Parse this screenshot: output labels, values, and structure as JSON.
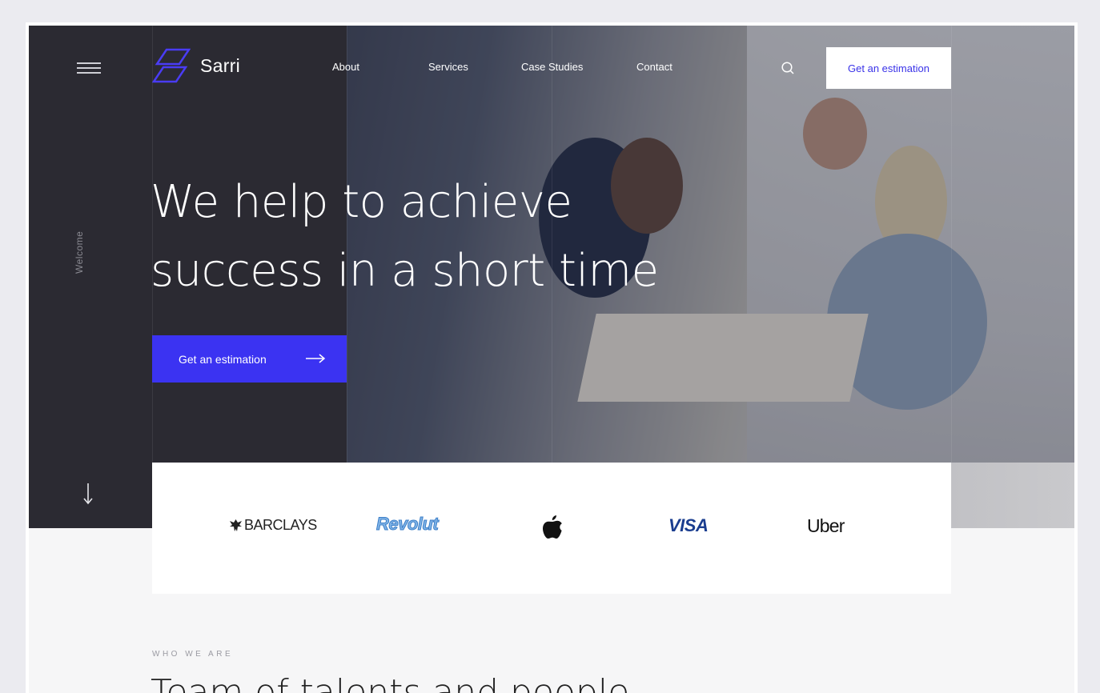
{
  "brand": {
    "name": "Sarri",
    "accent": "#3b33f2",
    "dark": "#2b2a32"
  },
  "rail": {
    "menu_icon": "hamburger-icon",
    "vertical_label": "Welcome",
    "scroll_icon": "arrow-down-icon"
  },
  "nav": {
    "items": [
      "About",
      "Services",
      "Case Studies",
      "Contact"
    ],
    "search_icon": "search-icon"
  },
  "header": {
    "cta_label": "Get an estimation"
  },
  "hero": {
    "headline_line1": "We help to achieve",
    "headline_line2": "success in a short time",
    "cta_label": "Get an estimation",
    "cta_icon": "arrow-right-icon"
  },
  "clients": {
    "logos": [
      {
        "name": "BARCLAYS",
        "icon": "barclays-eagle-icon"
      },
      {
        "name": "Revolut"
      },
      {
        "name": "Apple",
        "icon": "apple-logo-icon"
      },
      {
        "name": "VISA"
      },
      {
        "name": "Uber"
      }
    ]
  },
  "about": {
    "eyebrow": "WHO WE ARE",
    "title_partial": "Team of talents and people"
  }
}
